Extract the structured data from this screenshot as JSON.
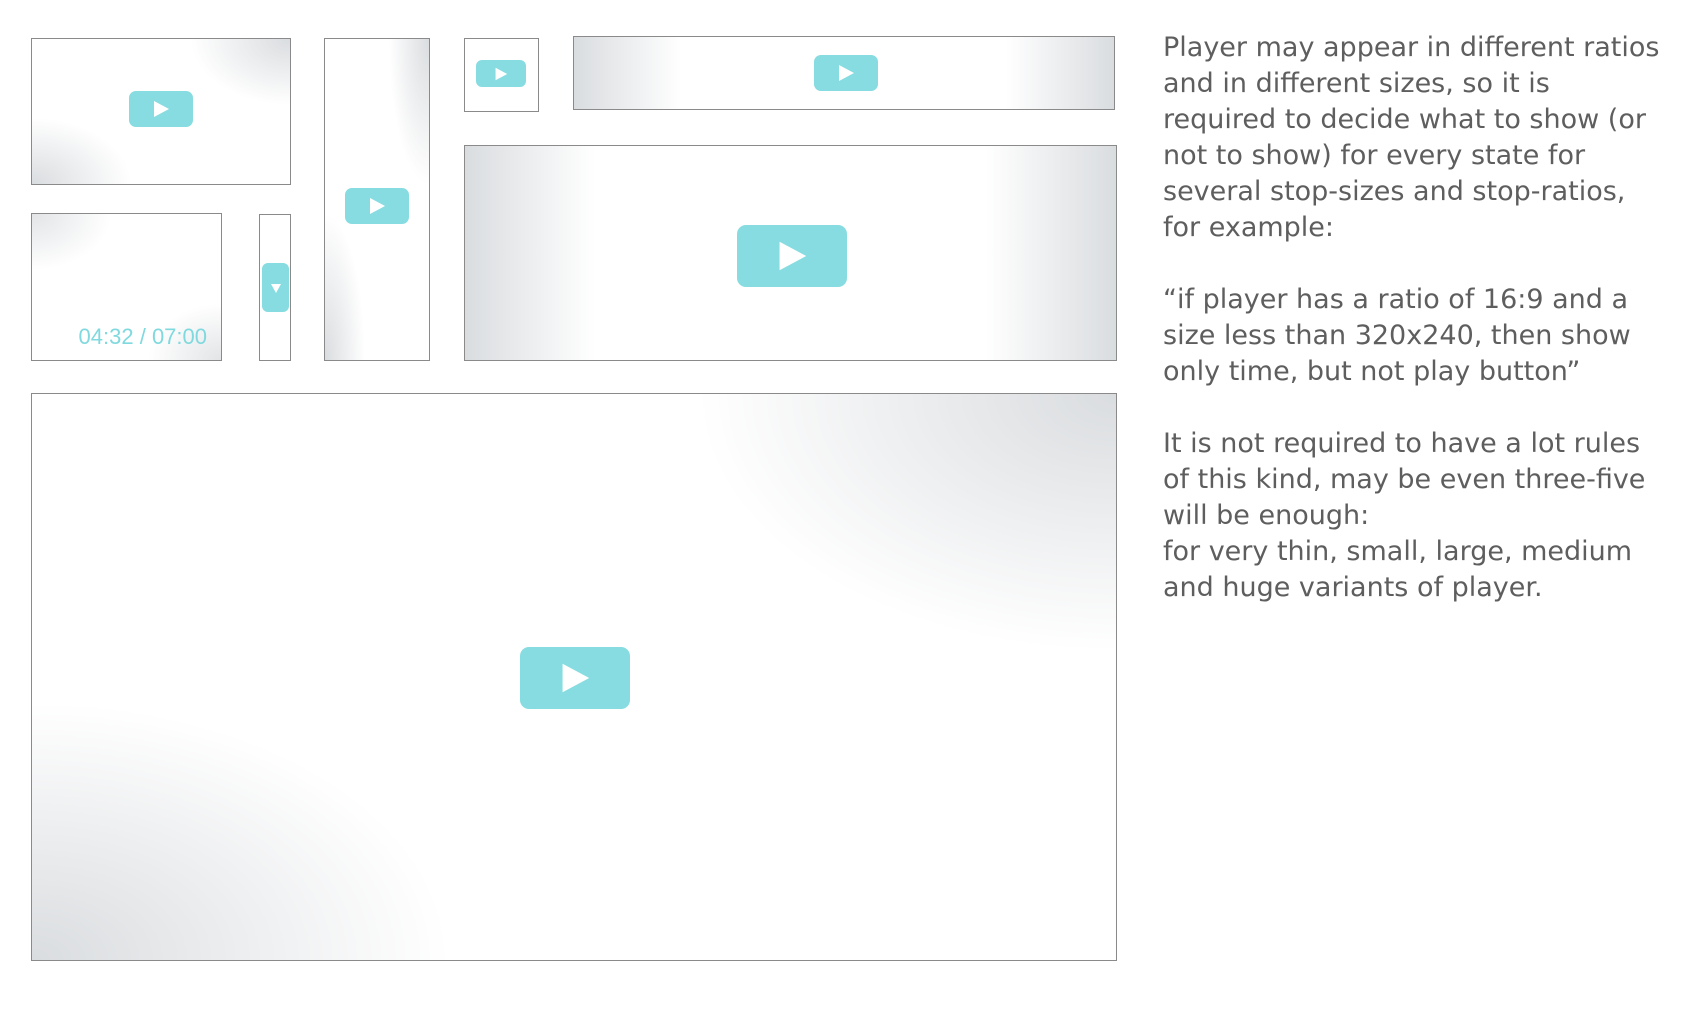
{
  "players": [
    {
      "size_class": "small",
      "shows_play_button": true,
      "play_icon": "play-icon"
    },
    {
      "size_class": "tall",
      "shows_play_button": true,
      "play_icon": "play-icon"
    },
    {
      "size_class": "tiny",
      "shows_play_button": true,
      "play_icon": "play-icon"
    },
    {
      "size_class": "wide-thin",
      "shows_play_button": true,
      "play_icon": "play-icon"
    },
    {
      "size_class": "small-time-only",
      "shows_play_button": false,
      "time_text": "04:32 / 07:00"
    },
    {
      "size_class": "very-thin",
      "shows_play_button": true,
      "play_icon": "down-triangle-icon"
    },
    {
      "size_class": "medium",
      "shows_play_button": true,
      "play_icon": "play-icon"
    },
    {
      "size_class": "huge",
      "shows_play_button": true,
      "play_icon": "play-icon"
    }
  ],
  "description": {
    "paragraph_1": "Player may appear in different ratios and in different sizes, so it is required to decide what to show (or not to show) for every state for several stop-sizes and stop-ratios, for example:",
    "paragraph_2": "“if player has a ratio of 16:9 and a size less than 320x240, then show only time, but not play button”",
    "paragraph_3": "It is not required to have a lot rules of this kind, may be even three-five will be enough:",
    "paragraph_4": "for very thin, small, large, medium and huge variants of player."
  },
  "colors": {
    "accent": "#86dce0",
    "time_text": "#7fd9de",
    "border": "#8a8a8a",
    "body_text": "#5e5e5e"
  }
}
